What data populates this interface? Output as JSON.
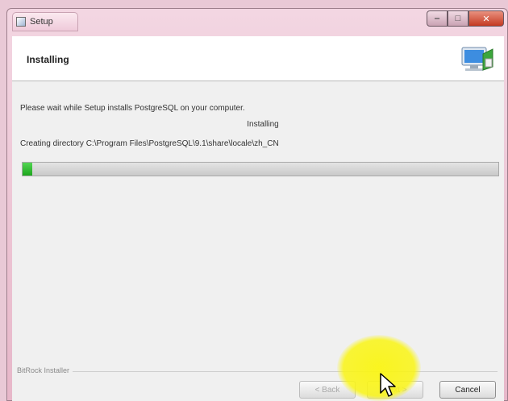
{
  "window": {
    "title": "Setup"
  },
  "header": {
    "title": "Installing"
  },
  "body": {
    "line1": "Please wait while Setup installs PostgreSQL on your computer.",
    "line2": "Installing",
    "line3": "Creating directory C:\\Program Files\\PostgreSQL\\9.1\\share\\locale\\zh_CN"
  },
  "progress": {
    "fraction": 0.02
  },
  "footer": {
    "brand": "BitRock Installer",
    "back_label": "< Back",
    "next_label": "Next >",
    "cancel_label": "Cancel"
  },
  "icons": {
    "app": "setup-app-icon",
    "header": "computer-install-icon",
    "cursor": "mouse-pointer-icon"
  }
}
